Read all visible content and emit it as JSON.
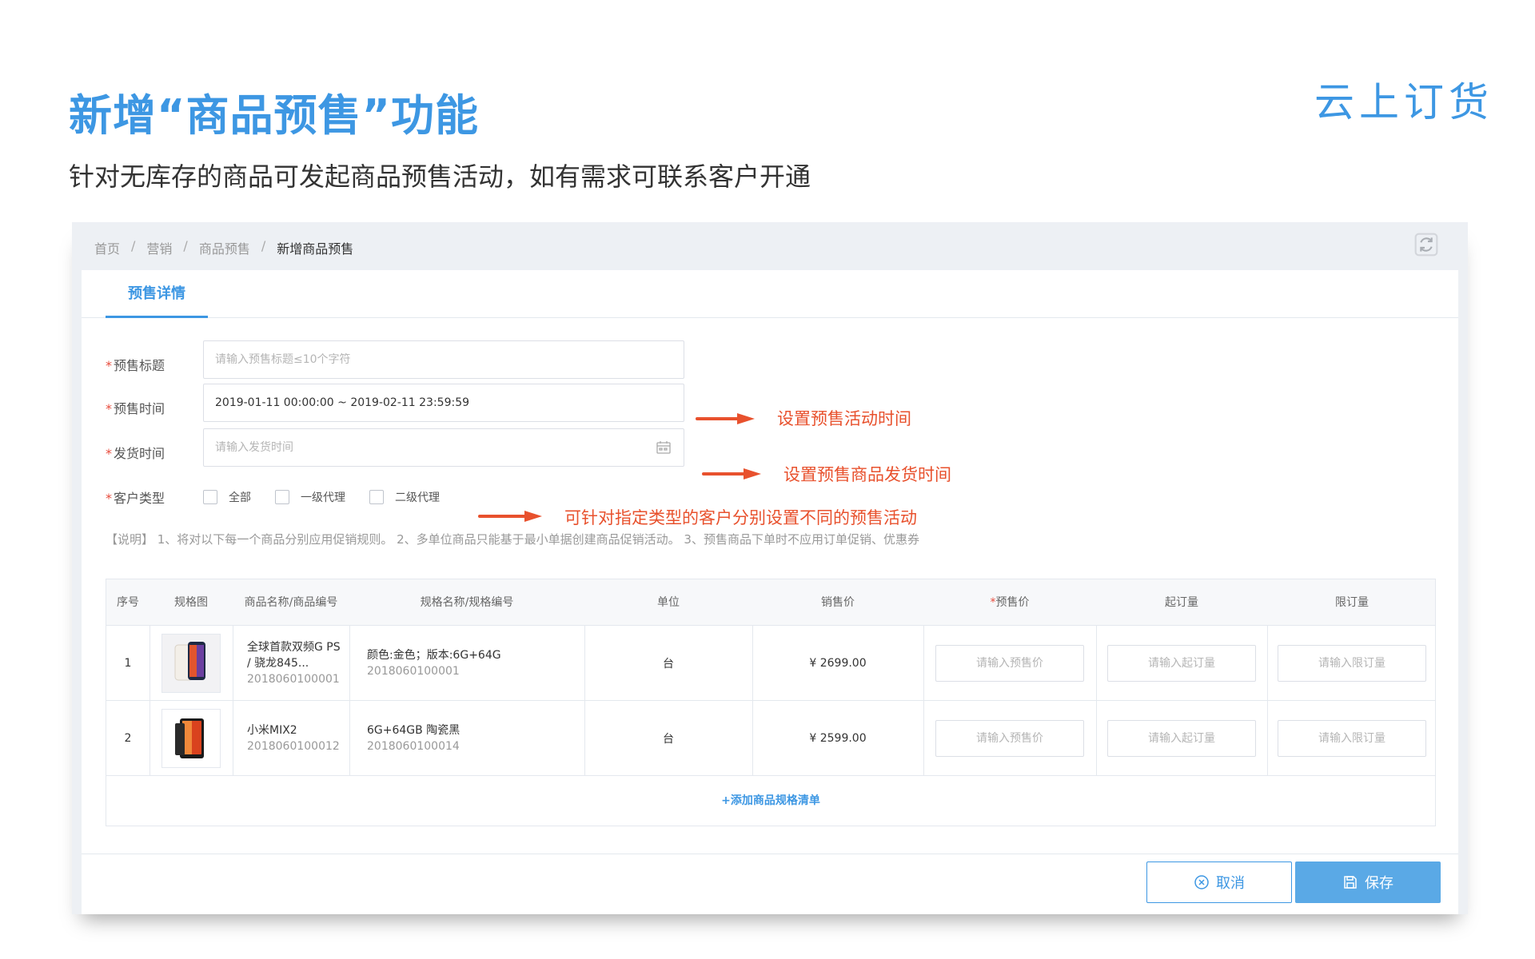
{
  "slide": {
    "title": "新增“商品预售”功能",
    "subtitle": "针对无库存的商品可发起商品预售活动，如有需求可联系客户开通",
    "logo": "云上订货"
  },
  "breadcrumb": [
    "首页",
    "营销",
    "商品预售",
    "新增商品预售"
  ],
  "tab": {
    "label": "预售详情"
  },
  "form": {
    "title_label": "预售标题",
    "title_placeholder": "请输入预售标题≤10个字符",
    "time_label": "预售时间",
    "time_value": "2019-01-11 00:00:00 ~ 2019-02-11 23:59:59",
    "ship_label": "发货时间",
    "ship_placeholder": "请输入发货时间",
    "customer_label": "客户类型",
    "customer_options": [
      "全部",
      "一级代理",
      "二级代理"
    ],
    "note": "【说明】 1、将对以下每一个商品分别应用促销规则。 2、多单位商品只能基于最小单据创建商品促销活动。 3、预售商品下单时不应用订单促销、优惠券"
  },
  "annotations": {
    "time": "设置预售活动时间",
    "ship": "设置预售商品发货时间",
    "customer": "可针对指定类型的客户分别设置不同的预售活动"
  },
  "table": {
    "headers": {
      "index": "序号",
      "image": "规格图",
      "product": "商品名称/商品编号",
      "spec": "规格名称/规格编号",
      "unit": "单位",
      "price": "销售价",
      "presale": "预售价",
      "min": "起订量",
      "max": "限订量"
    },
    "rows": [
      {
        "index": "1",
        "name": "全球首款双频G PS / 骁龙845...",
        "code": "2018060100001",
        "spec": "颜色:金色；版本:6G+64G",
        "spec_code": "2018060100001",
        "unit": "台",
        "price": "¥ 2699.00"
      },
      {
        "index": "2",
        "name": "小米MIX2",
        "code": "2018060100012",
        "spec": "6G+64GB 陶瓷黑",
        "spec_code": "2018060100014",
        "unit": "台",
        "price": "¥ 2599.00"
      }
    ],
    "placeholders": {
      "presale": "请输入预售价",
      "min": "请输入起订量",
      "max": "请输入限订量"
    },
    "add_link": "+添加商品规格清单"
  },
  "buttons": {
    "cancel": "取消",
    "save": "保存"
  },
  "colors": {
    "accent": "#3d97e3",
    "annotation": "#e8512d",
    "required": "#e84c3d"
  }
}
